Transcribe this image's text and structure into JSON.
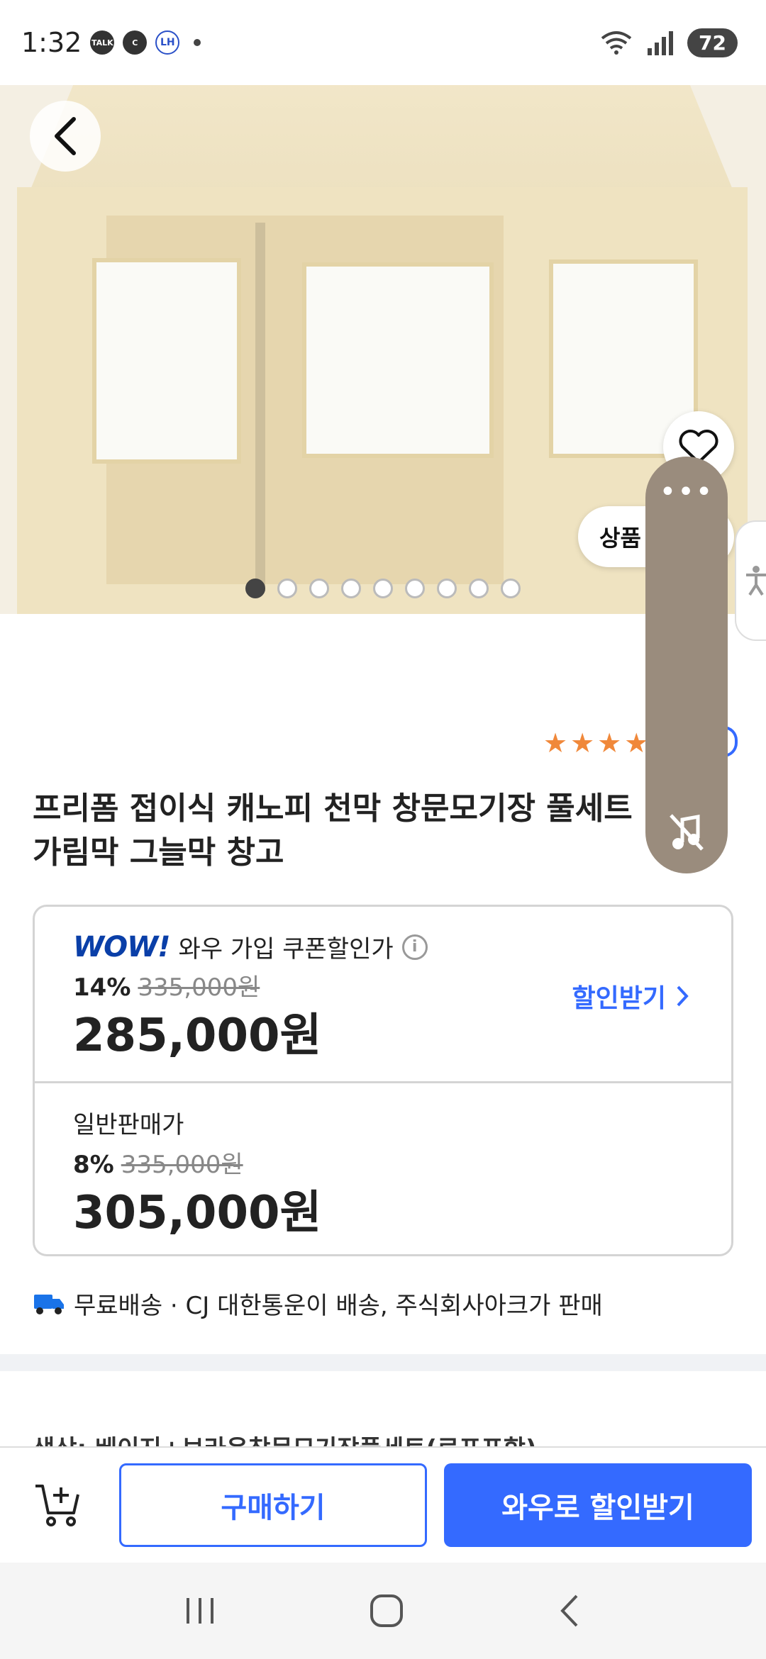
{
  "status_bar": {
    "time": "1:32",
    "icons": [
      "talk-icon",
      "c-icon",
      "lh-icon",
      "dot"
    ],
    "talk_label": "TALK",
    "c_label": "C",
    "lh_label": "LH",
    "battery": "72"
  },
  "gallery": {
    "image_count": 9,
    "active_index": 0,
    "product_pill_label": "상품"
  },
  "rating": {
    "stars": 5
  },
  "product": {
    "title": "프리폼 접이식 캐노피 천막 창문모기장 풀세트 가림막 그늘막 창고"
  },
  "price": {
    "wow_logo": "WOW!",
    "wow_label": "와우 가입 쿠폰할인가",
    "info_icon": "i",
    "wow_discount": "14%",
    "wow_original": "335,000원",
    "wow_price": "285,000원",
    "coupon_link": "할인받기",
    "normal_label": "일반판매가",
    "normal_discount": "8%",
    "normal_original": "335,000원",
    "normal_price": "305,000원"
  },
  "delivery": {
    "text": "무료배송 · CJ 대한통운이 배송, 주식회사아크가 판매"
  },
  "option_preview": "색상: 베이지+브라운창문모기장풀세트(로프포함)",
  "bottom_bar": {
    "buy_label": "구매하기",
    "wow_label": "와우로 할인받기"
  },
  "colors": {
    "accent": "#346aff",
    "wow_navy": "#0a3fa8",
    "star": "#f0883a",
    "panel": "#9a8c7d"
  }
}
